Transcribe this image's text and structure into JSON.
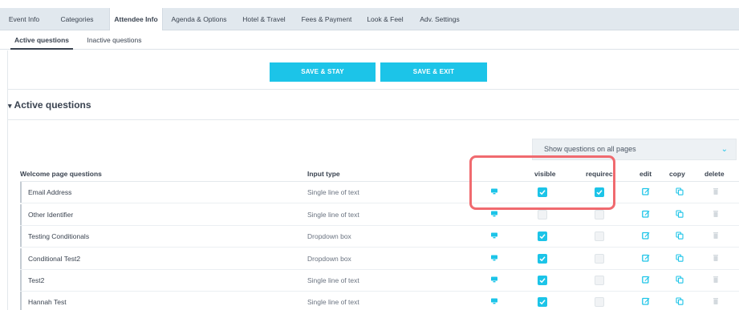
{
  "top_tabs": [
    "Event Info",
    "Categories",
    "Attendee Info",
    "Agenda & Options",
    "Hotel & Travel",
    "Fees & Payment",
    "Look & Feel",
    "Adv. Settings"
  ],
  "sub_tabs": [
    "Active questions",
    "Inactive questions"
  ],
  "buttons": {
    "save_stay": "SAVE & STAY",
    "save_exit": "SAVE & EXIT"
  },
  "section": {
    "title": "Active questions",
    "arrow": "▾"
  },
  "pages_select": {
    "value": "Show questions on all pages",
    "chevron": "⌄"
  },
  "table": {
    "headers": {
      "name": "Welcome page questions",
      "type": "Input type",
      "visible": "visible",
      "required": "requirec",
      "edit": "edit",
      "copy": "copy",
      "delete": "delete"
    },
    "rows": [
      {
        "name": "Email Address",
        "type": "Single line of text",
        "visible": true,
        "required": true
      },
      {
        "name": "Other Identifier",
        "type": "Single line of text",
        "visible": false,
        "required": false
      },
      {
        "name": "Testing Conditionals",
        "type": "Dropdown box",
        "visible": true,
        "required": false
      },
      {
        "name": "Conditional Test2",
        "type": "Dropdown box",
        "visible": true,
        "required": false
      },
      {
        "name": "Test2",
        "type": "Single line of text",
        "visible": true,
        "required": false
      },
      {
        "name": "Hannah Test",
        "type": "Single line of text",
        "visible": true,
        "required": false
      }
    ]
  },
  "colors": {
    "accent": "#1cc4e8",
    "highlight": "#f06a6f",
    "tabbar": "#e1e8ee"
  },
  "icons": {
    "monitor": "monitor-icon",
    "edit": "edit-icon",
    "copy": "copy-icon",
    "delete": "trash-icon",
    "check": "check-icon"
  }
}
